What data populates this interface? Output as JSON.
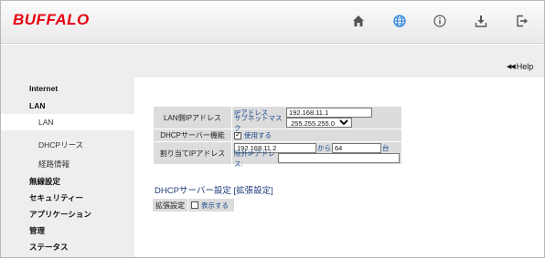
{
  "brand": {
    "logo_text": "BUFFALO",
    "logo_color": "#e60012",
    "accent": "#1a4a8c"
  },
  "nav": {
    "icons": [
      "home-icon",
      "globe-icon",
      "info-icon",
      "download-icon",
      "logout-icon"
    ],
    "help_label": "Help"
  },
  "sidebar": {
    "items": [
      {
        "label": "Internet",
        "level": "top"
      },
      {
        "label": "LAN",
        "level": "top"
      },
      {
        "label": "LAN",
        "level": "sub",
        "active": true
      },
      {
        "label": "DHCPリース",
        "level": "sub"
      },
      {
        "label": "経路情報",
        "level": "sub"
      },
      {
        "label": "無線設定",
        "level": "top"
      },
      {
        "label": "セキュリティー",
        "level": "top"
      },
      {
        "label": "アプリケーション",
        "level": "top"
      },
      {
        "label": "管理",
        "level": "top"
      },
      {
        "label": "ステータス",
        "level": "top"
      }
    ]
  },
  "form": {
    "lan_ip_label": "LAN側IPアドレス",
    "ip_address_label": "IPアドレス",
    "ip_address_value": "192.168.11.1",
    "subnet_label": "サブネットマスク",
    "subnet_value": "255.255.255.0",
    "dhcp_label": "DHCPサーバー機能",
    "dhcp_use_label": "使用する",
    "dhcp_use_checked": true,
    "assign_label": "割り当てIPアドレス",
    "range_start": "192.168.11.2",
    "range_from_label": "から",
    "range_count": "64",
    "range_unit_label": "台",
    "exclude_label": "除外IPアドレス:",
    "exclude_value": ""
  },
  "advanced": {
    "title": "DHCPサーバー設定 [拡張設定]",
    "label": "拡張設定",
    "show_label": "表示する",
    "show_checked": false
  }
}
